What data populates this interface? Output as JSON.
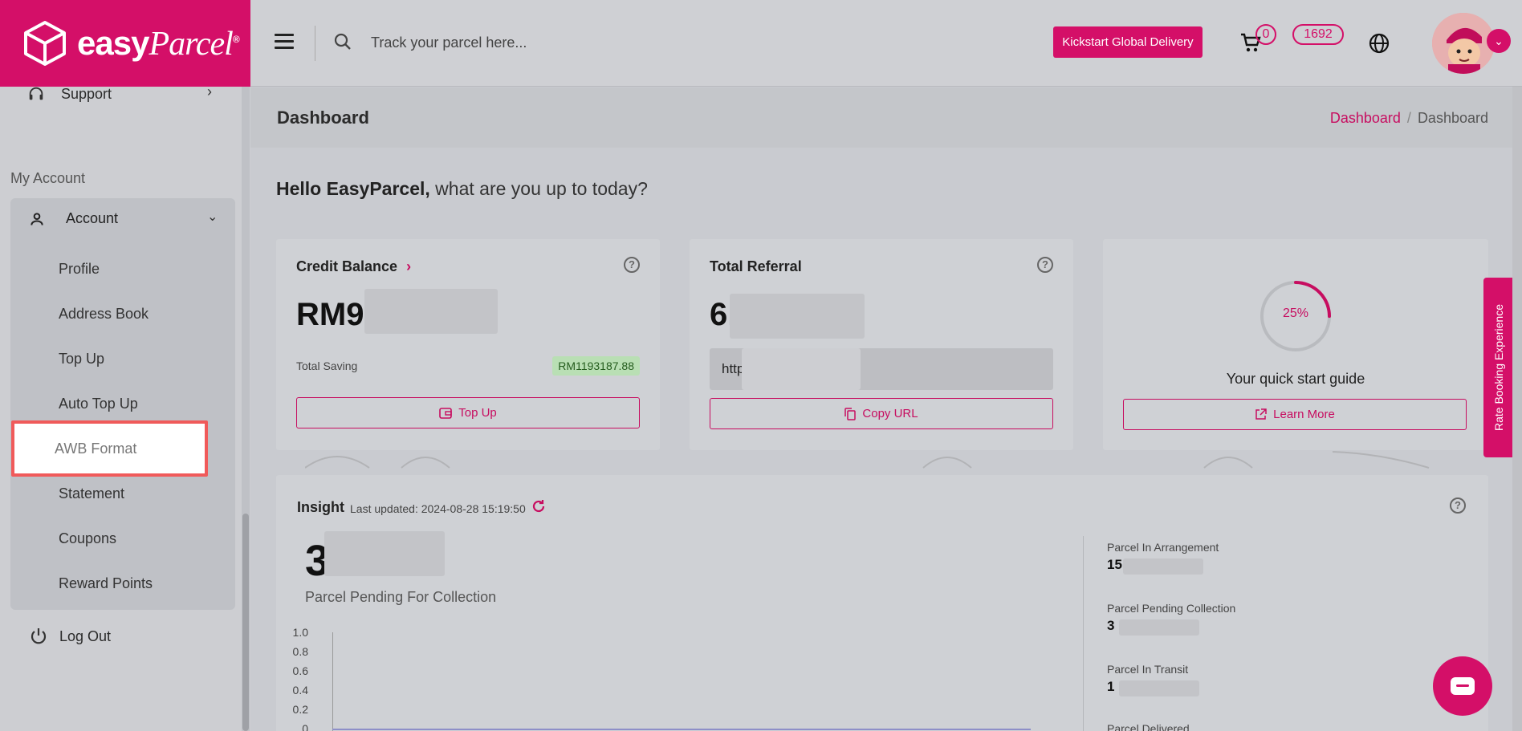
{
  "logo": {
    "text": "easy",
    "text_italic": "Parcel",
    "mark": "®"
  },
  "header": {
    "search_placeholder": "Track your parcel here...",
    "kickstart_label": "Kickstart Global Delivery",
    "cart_count": "0",
    "notification_count": "1692"
  },
  "sidebar": {
    "support_label": "Support",
    "section_label": "My Account",
    "account_label": "Account",
    "items": [
      "Profile",
      "Address Book",
      "Top Up",
      "Auto Top Up",
      "AWB Format",
      "Statement",
      "Coupons",
      "Reward Points"
    ],
    "logout_label": "Log Out"
  },
  "page": {
    "title": "Dashboard",
    "breadcrumb_link": "Dashboard",
    "breadcrumb_sep": "/",
    "breadcrumb_current": "Dashboard",
    "greeting_name": "Hello EasyParcel,",
    "greeting_rest": " what are you up to today?"
  },
  "credit": {
    "title": "Credit Balance",
    "value": "RM9",
    "saving_label": "Total Saving",
    "saving_value": "RM1193187.88",
    "button": "Top Up"
  },
  "referral": {
    "title": "Total Referral",
    "value": "6.",
    "url_prefix": "http",
    "button": "Copy URL"
  },
  "guide": {
    "progress_label": "25%",
    "progress": 0.25,
    "title": "Your quick start guide",
    "button": "Learn More"
  },
  "insight": {
    "title": "Insight",
    "updated": "Last updated: 2024-08-28 15:19:50",
    "big_value": "3",
    "big_label": "Parcel Pending For Collection",
    "y_ticks": [
      "1.0",
      "0.8",
      "0.6",
      "0.4",
      "0.2",
      "0"
    ],
    "stats": [
      {
        "label": "Parcel In Arrangement",
        "value": "15"
      },
      {
        "label": "Parcel Pending Collection",
        "value": "3"
      },
      {
        "label": "Parcel In Transit",
        "value": "1"
      },
      {
        "label": "Parcel Delivered",
        "value": ""
      }
    ]
  },
  "rate_tab": "Rate Booking Experience",
  "colors": {
    "brand": "#d40f68",
    "highlight": "#f05a5a"
  }
}
